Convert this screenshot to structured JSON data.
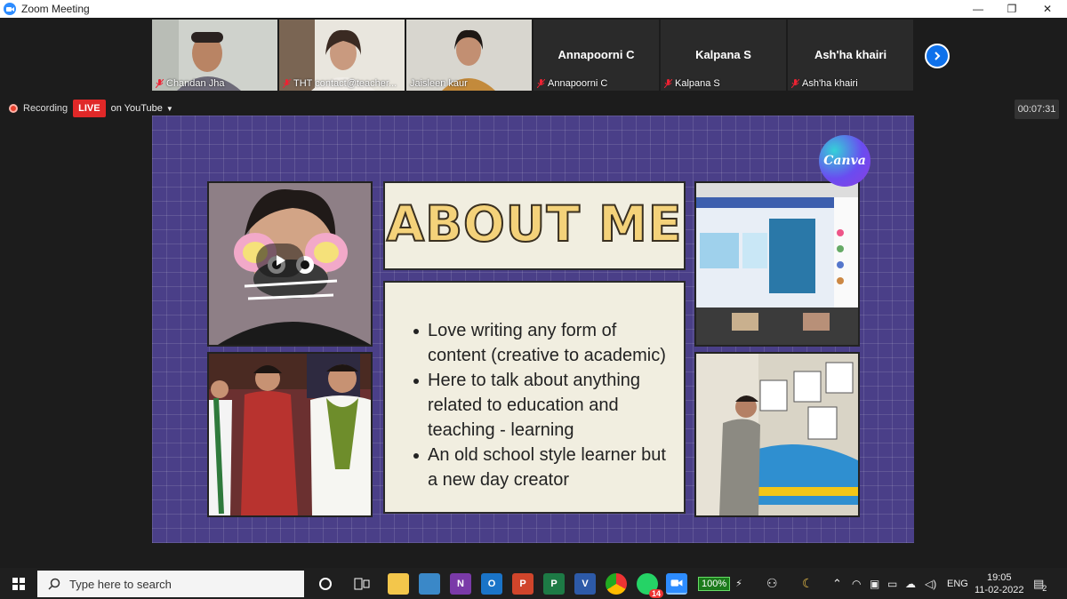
{
  "window": {
    "title": "Zoom Meeting",
    "minimize": "—",
    "restore": "❐",
    "close": "✕"
  },
  "participants": [
    {
      "name": "Chandan Jha",
      "has_video": true
    },
    {
      "name": "THT contact@teacher...",
      "has_video": true
    },
    {
      "name": "Jaisleen kaur",
      "has_video": true,
      "active": true
    },
    {
      "name": "Annapoorni C",
      "display": "Annapoorni C",
      "has_video": false
    },
    {
      "name": "Kalpana S",
      "display": "Kalpana S",
      "has_video": false
    },
    {
      "name": "Ash'ha khairi",
      "display": "Ash'ha khairi",
      "has_video": false
    }
  ],
  "recording": {
    "label": "Recording",
    "live": "LIVE",
    "stream": "on YouTube"
  },
  "timer": "00:07:31",
  "slide": {
    "title": "ABOUT ME",
    "bullets": [
      "Love writing any form of content (creative to academic)",
      "Here to talk about anything related to education and teaching - learning",
      "An old school style learner but a new day creator"
    ],
    "badge": "Canva"
  },
  "taskbar": {
    "search_placeholder": "Type here to search",
    "battery": "100%",
    "language": "ENG",
    "time": "19:05",
    "date": "11-02-2022",
    "notifications": "2",
    "whatsapp_badge": "14"
  },
  "colors": {
    "slide_bg": "#4a3f88",
    "card": "#f1eee0",
    "title": "#f4d27a",
    "live": "#e02828",
    "accent": "#0e71eb"
  }
}
